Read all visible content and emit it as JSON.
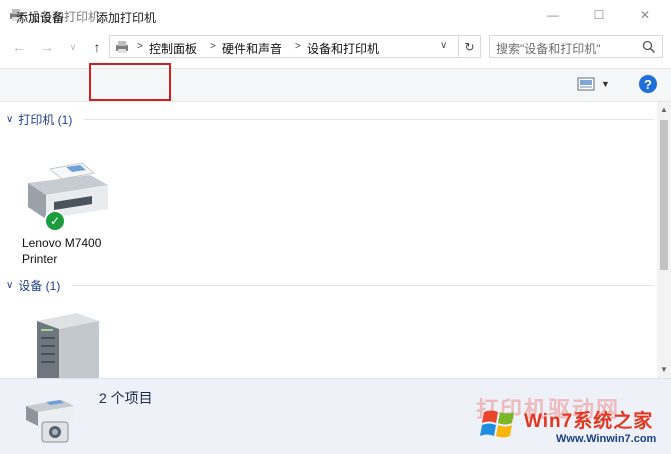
{
  "window": {
    "title": "设备和打印机",
    "minimize_glyph": "—",
    "maximize_glyph": "☐",
    "close_glyph": "✕"
  },
  "address": {
    "breadcrumbs": [
      "控制面板",
      "硬件和声音",
      "设备和打印机"
    ],
    "separator": ">",
    "search_placeholder": "搜索\"设备和打印机\""
  },
  "commands": {
    "add_device": "添加设备",
    "add_printer": "添加打印机"
  },
  "groups": [
    {
      "label": "打印机 (1)",
      "items": [
        {
          "name_line1": "Lenovo M7400",
          "name_line2": "Printer",
          "status": "default-printer-check-icon"
        }
      ]
    },
    {
      "label": "设备 (1)",
      "items": [
        {
          "icon": "computer-tower-icon"
        }
      ]
    }
  ],
  "details": {
    "item_count": "2 个项目"
  },
  "watermark": {
    "brand": "打印机驱动网",
    "title": "Win7系统之家",
    "url": "Www.Winwin7.com"
  },
  "colors": {
    "highlight_border": "#d21f1f",
    "group_header": "#1e3f8a",
    "help_icon": "#1e6fd9",
    "status_check": "#1a9c3f",
    "details_background": "#eef2f8"
  }
}
